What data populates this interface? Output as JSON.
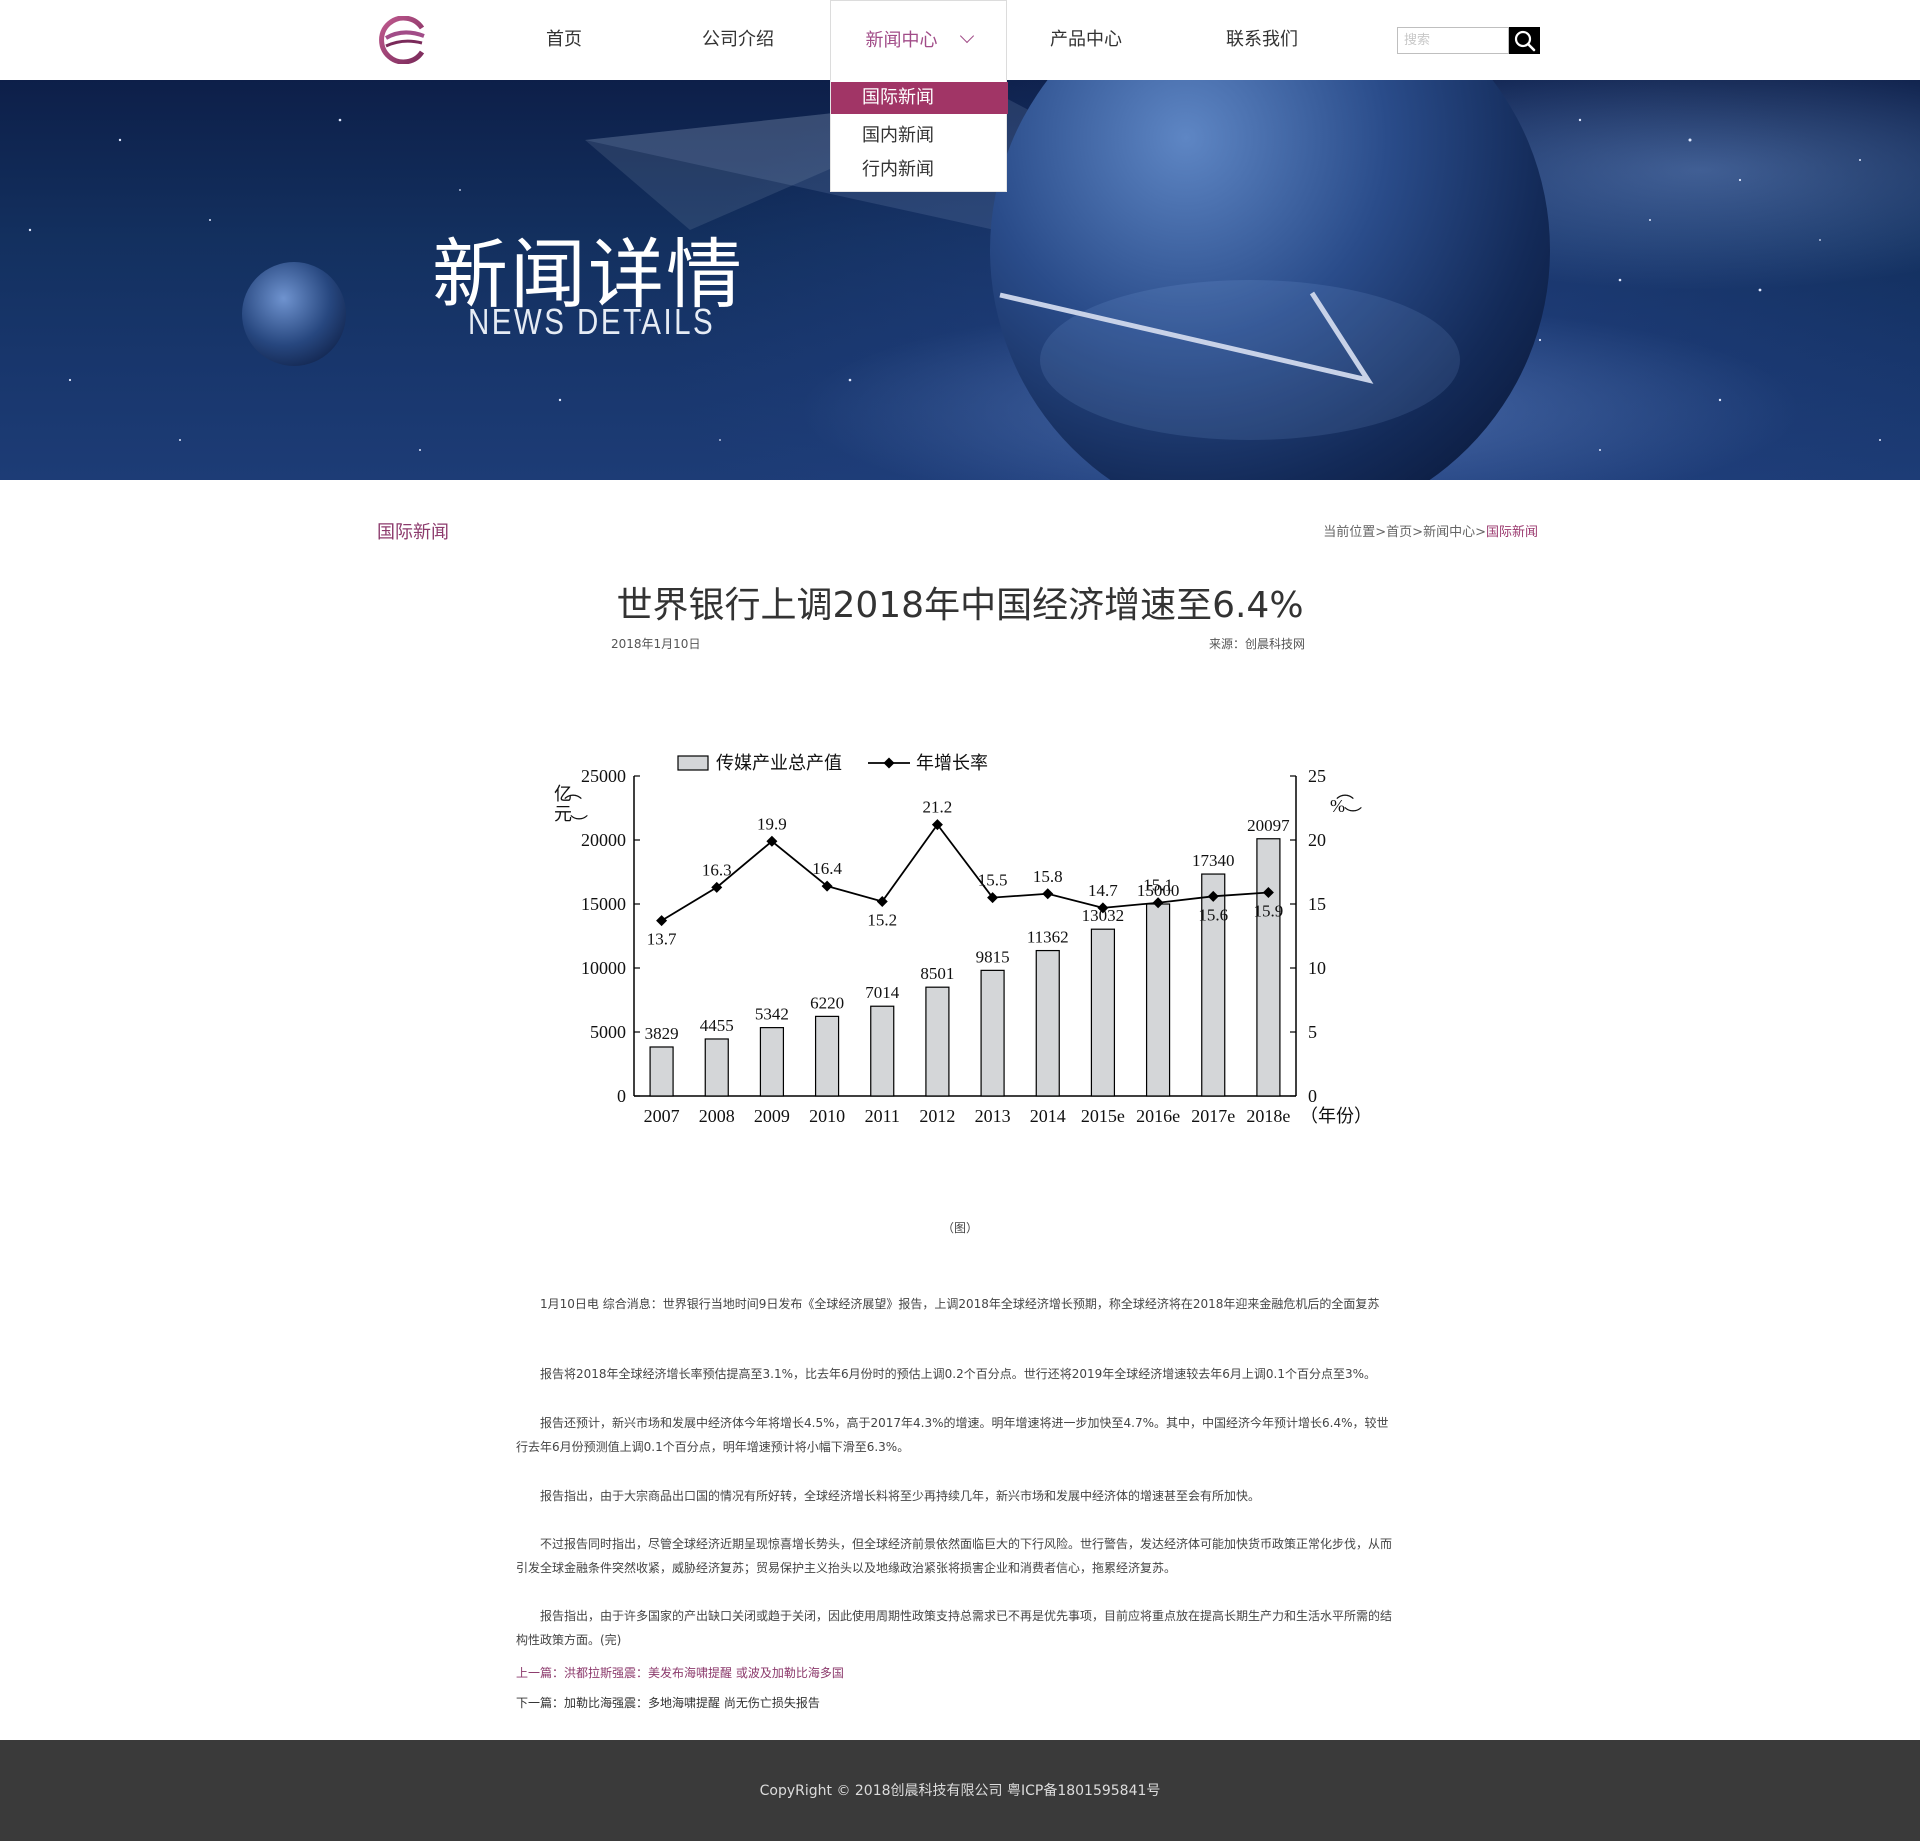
{
  "header": {
    "nav": [
      {
        "label": "首页"
      },
      {
        "label": "公司介绍"
      },
      {
        "label": "新闻中心"
      },
      {
        "label": "产品中心"
      },
      {
        "label": "联系我们"
      }
    ],
    "active_index": 2,
    "search_placeholder": "搜索",
    "dropdown": [
      {
        "label": "国际新闻"
      },
      {
        "label": "国内新闻"
      },
      {
        "label": "行内新闻"
      }
    ]
  },
  "banner": {
    "title": "新闻详情",
    "subtitle": "NEWS DETAILS"
  },
  "section_label": "国际新闻",
  "breadcrumb": {
    "prefix": "当前位置",
    "items": [
      "首页",
      "新闻中心",
      "国际新闻"
    ],
    "sep": ">"
  },
  "article": {
    "title": "世界银行上调2018年中国经济增速至6.4%",
    "date": "2018年1月10日",
    "source": "来源：创晨科技网",
    "figure_caption": "（图）",
    "paragraphs": [
      "1月10日电 综合消息：世界银行当地时间9日发布《全球经济展望》报告，上调2018年全球经济增长预期，称全球经济将在2018年迎来金融危机后的全面复苏",
      "报告将2018年全球经济增长率预估提高至3.1%，比去年6月份时的预估上调0.2个百分点。世行还将2019年全球经济增速较去年6月上调0.1个百分点至3%。",
      "报告还预计，新兴市场和发展中经济体今年将增长4.5%，高于2017年4.3%的增速。明年增速将进一步加快至4.7%。其中，中国经济今年预计增长6.4%，较世行去年6月份预测值上调0.1个百分点，明年增速预计将小幅下滑至6.3%。",
      "报告指出，由于大宗商品出口国的情况有所好转，全球经济增长料将至少再持续几年，新兴市场和发展中经济体的增速甚至会有所加快。",
      "不过报告同时指出，尽管全球经济近期呈现惊喜增长势头，但全球经济前景依然面临巨大的下行风险。世行警告，发达经济体可能加快货币政策正常化步伐，从而引发全球金融条件突然收紧，威胁经济复苏；贸易保护主义抬头以及地缘政治紧张将损害企业和消费者信心，拖累经济复苏。",
      "报告指出，由于许多国家的产出缺口关闭或趋于关闭，因此使用周期性政策支持总需求已不再是优先事项，目前应将重点放在提高长期生产力和生活水平所需的结构性政策方面。(完)"
    ],
    "prev": "上一篇：洪都拉斯强震：美发布海啸提醒 或波及加勒比海多国",
    "next": "下一篇：加勒比海强震：多地海啸提醒 尚无伤亡损失报告"
  },
  "footer": {
    "text": "CopyRight © 2018创晨科技有限公司 粤ICP备1801595841号"
  },
  "colors": {
    "accent": "#a13566",
    "accent_text": "#8c3a6c",
    "footer_bg": "#3a3a3a",
    "bar_fill": "#d4d6d8"
  },
  "chart_data": {
    "type": "bar",
    "categories": [
      "2007",
      "2008",
      "2009",
      "2010",
      "2011",
      "2012",
      "2013",
      "2014",
      "2015e",
      "2016e",
      "2017e",
      "2018e"
    ],
    "series": [
      {
        "name": "传媒产业总产值",
        "type": "bar",
        "axis": "left",
        "values": [
          3829,
          4455,
          5342,
          6220,
          7014,
          8501,
          9815,
          11362,
          13032,
          15000,
          17340,
          20097
        ]
      },
      {
        "name": "年增长率",
        "type": "line",
        "axis": "right",
        "values": [
          13.7,
          16.3,
          19.9,
          16.4,
          15.2,
          21.2,
          15.5,
          15.8,
          14.7,
          15.1,
          15.6,
          15.9
        ]
      }
    ],
    "ylabel_left": "（亿元）",
    "ylabel_right": "（%）",
    "xlabel": "（年份）",
    "ylim_left": [
      0,
      25000
    ],
    "ylim_right": [
      0,
      25
    ],
    "yticks_left": [
      0,
      5000,
      10000,
      15000,
      20000,
      25000
    ],
    "yticks_right": [
      0,
      5,
      10,
      15,
      20,
      25
    ],
    "legend_position": "top",
    "grid": false
  }
}
